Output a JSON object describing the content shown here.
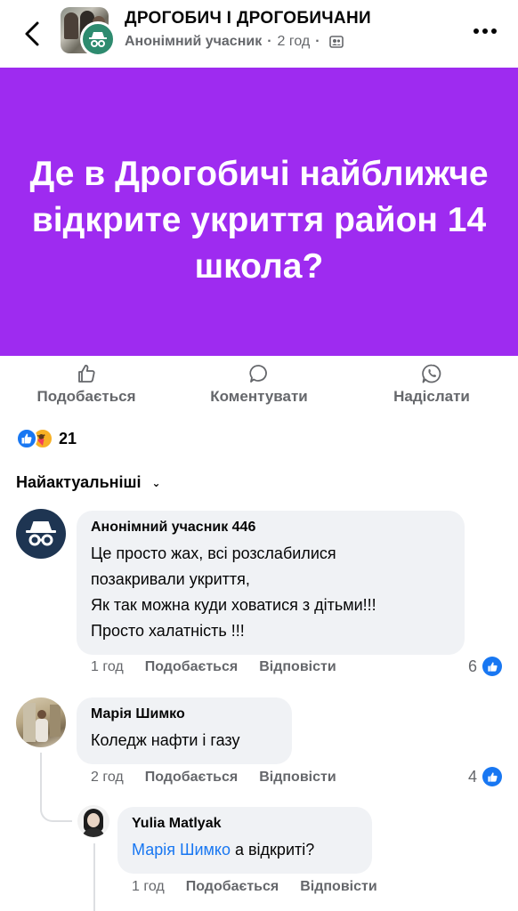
{
  "header": {
    "group_name": "ДРОГОБИЧ І ДРОГОБИЧАНИ",
    "author": "Анонімний учасник",
    "time": "2 год",
    "separator": "·"
  },
  "post": {
    "banner_text": "Де в Дрогобичі найближче відкрите укриття район 14 школа?",
    "banner_color": "#9e2bf0"
  },
  "actions": {
    "like": "Подобається",
    "comment": "Коментувати",
    "share": "Надіслати"
  },
  "reactions": {
    "count": "21",
    "types": [
      "like-icon",
      "care-icon"
    ]
  },
  "sort": {
    "label": "Найактуальніші"
  },
  "comments": [
    {
      "name": "Анонімний учасник 446",
      "lines": [
        "Це просто жах, всі розслабилися",
        "позакривали укриття,",
        "Як так можна куди ховатися з дітьми!!!",
        "Просто халатність !!!"
      ],
      "time": "1 год",
      "like": "Подобається",
      "reply": "Відповісти",
      "likes": "6"
    },
    {
      "name": "Марія Шимко",
      "lines": [
        "Коледж нафти і газу"
      ],
      "time": "2 год",
      "like": "Подобається",
      "reply": "Відповісти",
      "likes": "4"
    },
    {
      "name": "Yulia Matlyak",
      "mention": "Марія Шимко",
      "text": " а відкриті?",
      "time": "1 год",
      "like": "Подобається",
      "reply": "Відповісти"
    }
  ],
  "colors": {
    "accent": "#1877f2",
    "muted": "#65676b",
    "bubble": "#f0f2f5"
  }
}
